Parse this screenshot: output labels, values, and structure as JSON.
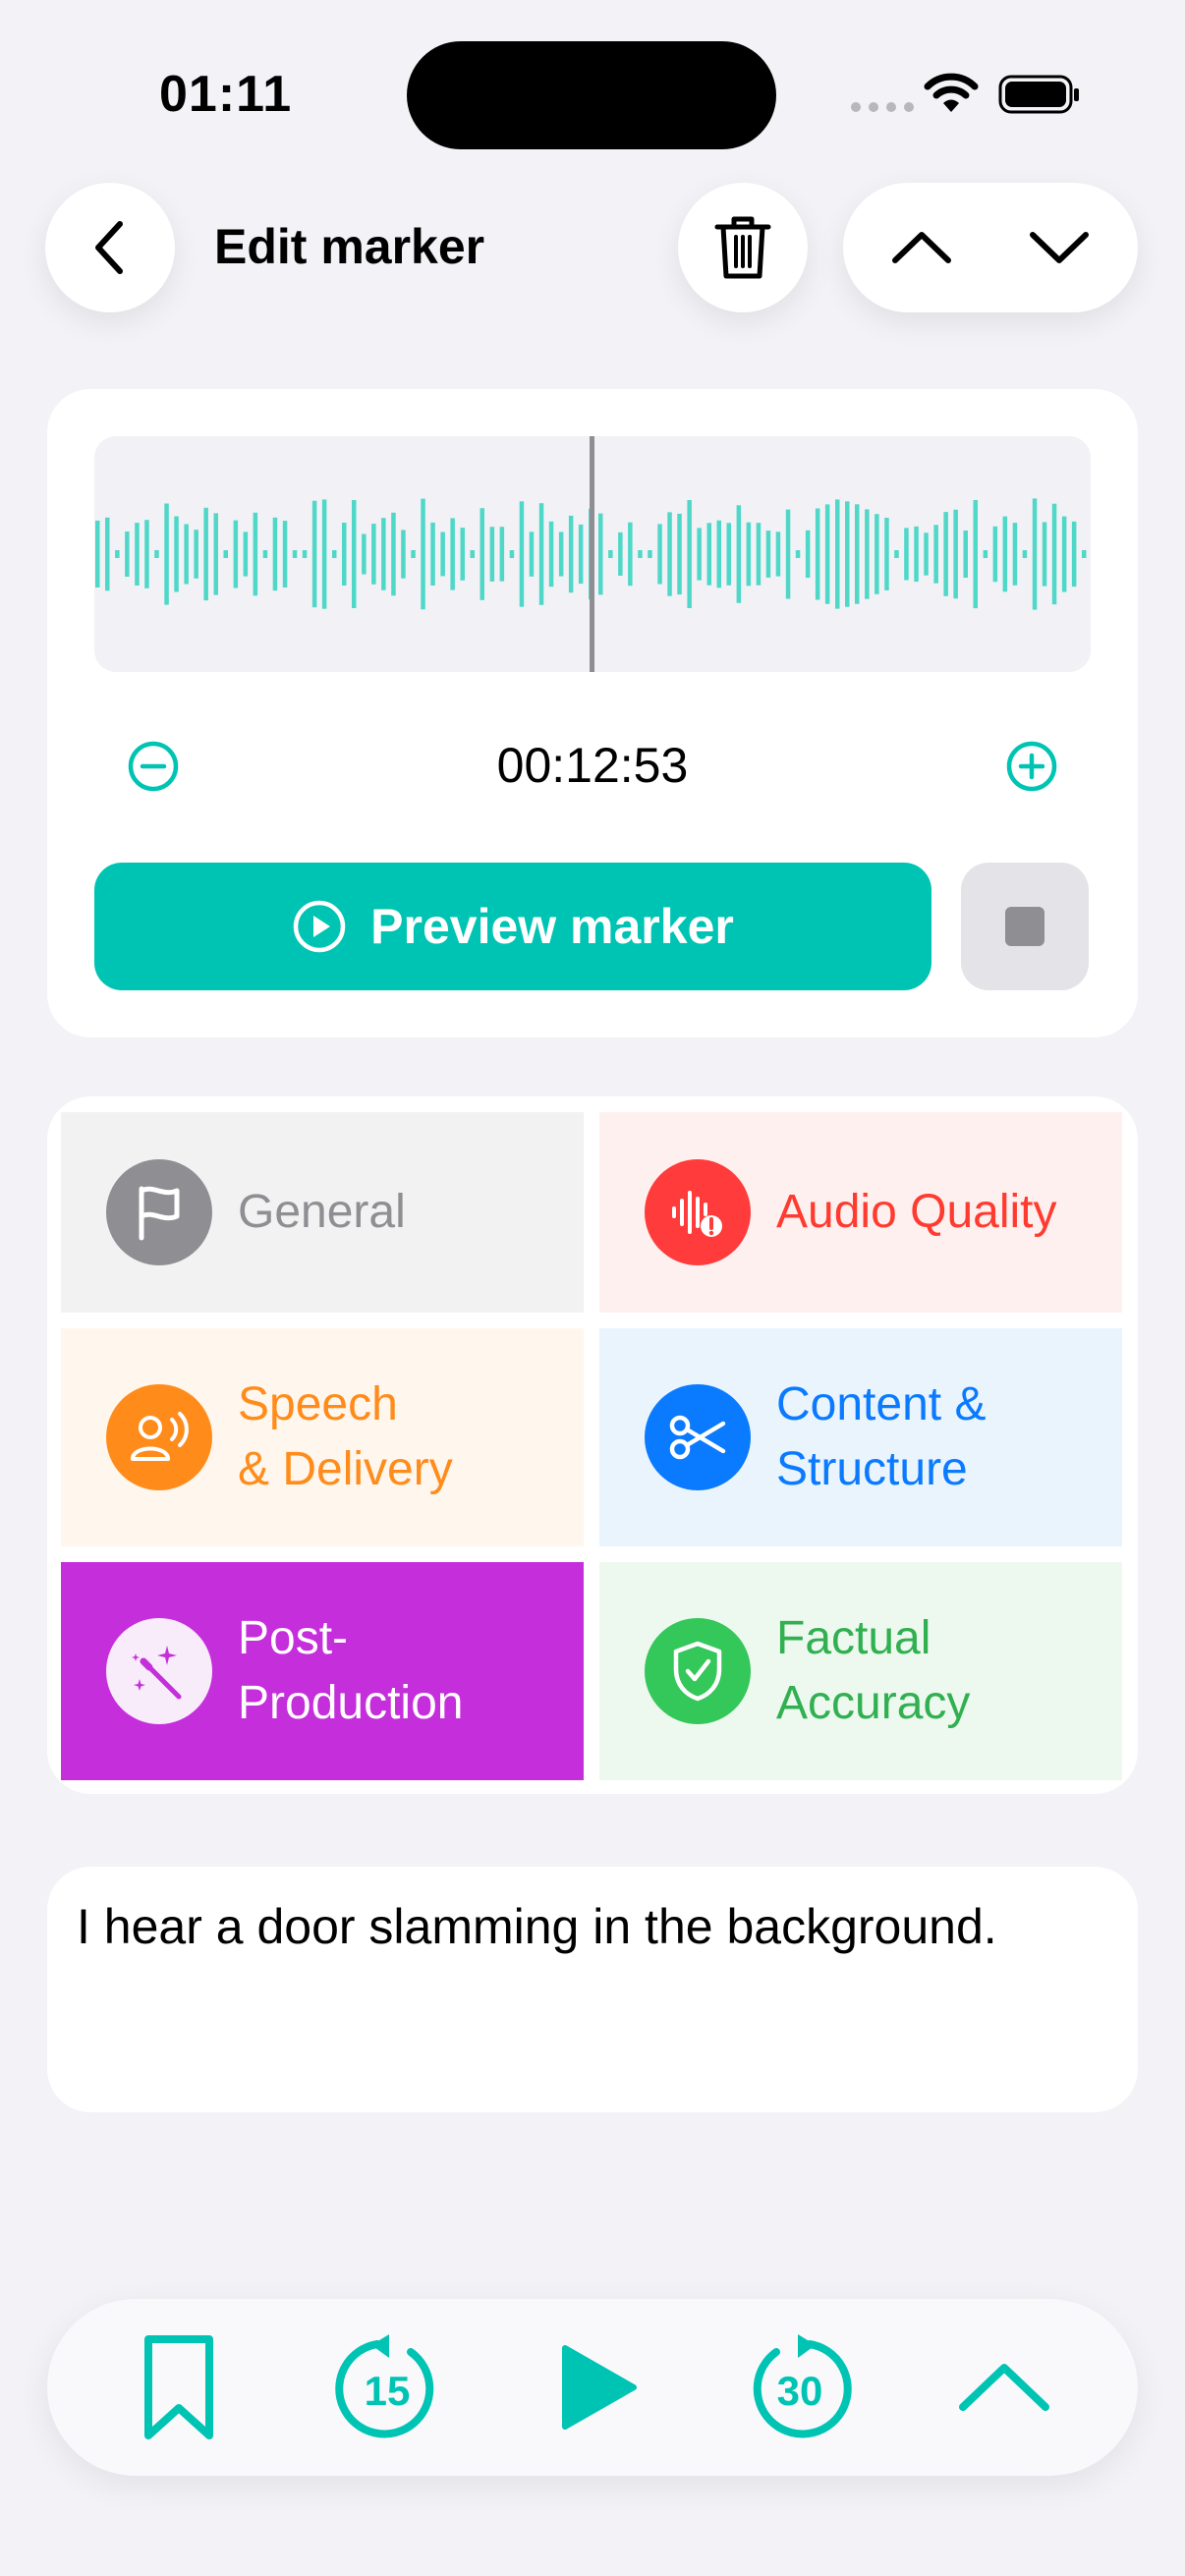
{
  "status_bar": {
    "time": "01:11"
  },
  "header": {
    "title": "Edit marker"
  },
  "player": {
    "timestamp": "00:12:53",
    "preview_label": "Preview marker",
    "accent": "#00C4B3"
  },
  "categories": [
    {
      "label": "General",
      "icon": "flag-icon",
      "text_color": "#8E8E93",
      "bg": "#F2F2F2",
      "icon_bg": "#8E8E93",
      "selected": false
    },
    {
      "label": "Audio Quality",
      "icon": "waveform-warning-icon",
      "text_color": "#FF3B30",
      "bg": "#FFF0F0",
      "icon_bg": "#FF3B3B",
      "selected": false
    },
    {
      "label": "Speech\n& Delivery",
      "icon": "speaking-person-icon",
      "text_color": "#FF8C1A",
      "bg": "#FFF6EE",
      "icon_bg": "#FF8C1A",
      "selected": false
    },
    {
      "label": "Content &\nStructure",
      "icon": "scissors-icon",
      "text_color": "#0A7AFF",
      "bg": "#EAF4FD",
      "icon_bg": "#0A7AFF",
      "selected": false
    },
    {
      "label": "Post-\nProduction",
      "icon": "magic-wand-icon",
      "text_color": "#FFFFFF",
      "bg": "#C52EDB",
      "icon_bg": "#F8ECFB",
      "selected": true
    },
    {
      "label": "Factual\nAccuracy",
      "icon": "shield-check-icon",
      "text_color": "#30B050",
      "bg": "#EDF8EF",
      "icon_bg": "#34C759",
      "selected": false
    }
  ],
  "note": {
    "text": "I hear a door slamming in the background."
  },
  "toolbar": {
    "skip_back_seconds": "15",
    "skip_forward_seconds": "30"
  }
}
